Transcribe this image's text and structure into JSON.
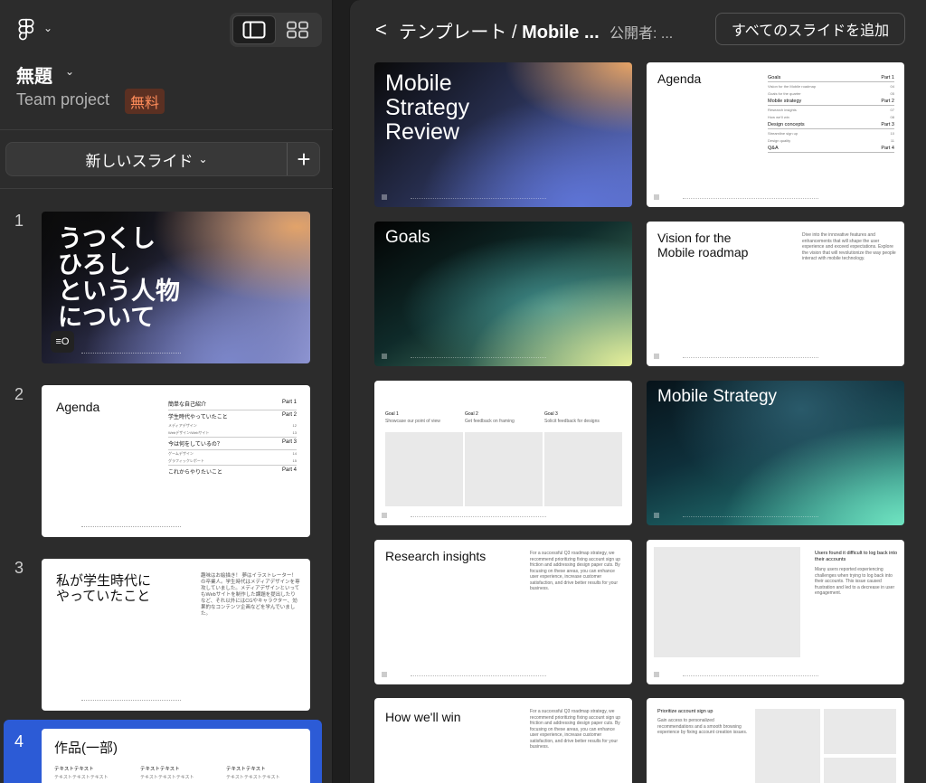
{
  "left_panel": {
    "file_title": "無題",
    "team_label": "Team project",
    "plan_badge": "無料",
    "new_slide_label": "新しいスライド",
    "add_label": "+",
    "slides": [
      {
        "number": "1",
        "title": "うつくし\nひろし\nという人物\nについて",
        "badge": "≡O"
      },
      {
        "number": "2",
        "title": "Agenda",
        "items": [
          {
            "label": "簡単な自己紹介",
            "part": "Part 1",
            "sub": false
          },
          {
            "label": "学生時代やっていたこと",
            "part": "Part 2",
            "sub": false
          },
          {
            "label": "メディアデザイン",
            "part": "12",
            "sub": true
          },
          {
            "label": "Webデザイン/Webサイト",
            "part": "13",
            "sub": true
          },
          {
            "label": "今は何をしているの？",
            "part": "Part 3",
            "sub": false
          },
          {
            "label": "ゲームデザイン",
            "part": "14",
            "sub": true
          },
          {
            "label": "グラフィックレポート",
            "part": "15",
            "sub": true
          },
          {
            "label": "これからやりたいこと",
            "part": "Part 4",
            "sub": false
          }
        ]
      },
      {
        "number": "3",
        "title": "私が学生時代に\nやっていたこと",
        "body": "趣味はお絵描き！ 夢はイラストレーター！ の卒業人。学生時代はメディアデザインを専攻していました。メディアデザインといってもWebサイトを制作した課題を提出したりなど、それ以外にはCGやキャラクター、効果的なコンテンツ企画などを学んでいました。"
      },
      {
        "number": "4",
        "title": "作品(一部)",
        "cols": [
          {
            "head": "テキストテキスト",
            "sub": "テキストテキストテキスト"
          },
          {
            "head": "テキストテキスト",
            "sub": "テキストテキストテキスト"
          },
          {
            "head": "テキストテキスト",
            "sub": "テキストテキストテキスト"
          }
        ]
      }
    ]
  },
  "right_panel": {
    "back_label": "<",
    "breadcrumb_parent": "テンプレート /",
    "breadcrumb_current": "Mobile ...",
    "publisher": "公開者: ...",
    "add_all_label": "すべてのスライドを追加",
    "templates": {
      "cover_title": "Mobile\nStrategy\nReview",
      "agenda": {
        "title": "Agenda",
        "rows": [
          {
            "label": "Goals",
            "part": "Part 1",
            "sub": false
          },
          {
            "label": "Vision for the Mobile roadmap",
            "part": "04",
            "sub": true
          },
          {
            "label": "Goals for the quarter",
            "part": "05",
            "sub": true
          },
          {
            "label": "Mobile strategy",
            "part": "Part 2",
            "sub": false
          },
          {
            "label": "Research insights",
            "part": "07",
            "sub": true
          },
          {
            "label": "How we'll win",
            "part": "08",
            "sub": true
          },
          {
            "label": "Design concepts",
            "part": "Part 3",
            "sub": false
          },
          {
            "label": "Streamline sign up",
            "part": "10",
            "sub": true
          },
          {
            "label": "Design quality",
            "part": "11",
            "sub": true
          },
          {
            "label": "Q&A",
            "part": "Part 4",
            "sub": false
          }
        ]
      },
      "goals_title": "Goals",
      "vision": {
        "title": "Vision for the\nMobile roadmap",
        "body": "Dive into the innovative features and enhancements that will shape the user experience and exceed expectations. Explore the vision that will revolutionize the way people interact with mobile technology."
      },
      "goal_cols": [
        {
          "head": "Goal 1",
          "sub": "Showcase our point of view"
        },
        {
          "head": "Goal 2",
          "sub": "Get feedback on framing"
        },
        {
          "head": "Goal 3",
          "sub": "Solicit feedback for designs"
        }
      ],
      "strategy_title": "Mobile Strategy",
      "research": {
        "title": "Research insights",
        "body": "For a successful Q3 roadmap strategy, we recommend prioritizing fixing account sign up friction and addressing design paper cuts. By focusing on these areas, you can enhance user experience, increase customer satisfaction, and drive better results for your business."
      },
      "login": {
        "head": "Users found it difficult to log back into their accounts",
        "body": "Many users reported experiencing challenges when trying to log back into their accounts. This issue caused frustration and led to a decrease in user engagement."
      },
      "win": {
        "title": "How we'll win",
        "body": "For a successful Q3 roadmap strategy, we recommend prioritizing fixing account sign up friction and addressing design paper cuts. By focusing on these areas, you can enhance user experience, increase customer satisfaction, and drive better results for your business."
      },
      "signup": {
        "head": "Prioritize account sign up",
        "body": "Gain access to personalized recommendations and a smooth browsing experience by fixing account creation issues."
      }
    }
  },
  "colors": {
    "panel_bg": "#2c2c2c",
    "app_bg": "#1e1e1e",
    "selection": "#2c5bd6",
    "badge_text": "#ff8c5a",
    "badge_bg": "#5b3022"
  },
  "icons": [
    "figma-logo-icon",
    "chevron-down-icon",
    "sidebar-view-icon",
    "grid-view-icon",
    "plus-icon",
    "back-chevron-icon"
  ]
}
